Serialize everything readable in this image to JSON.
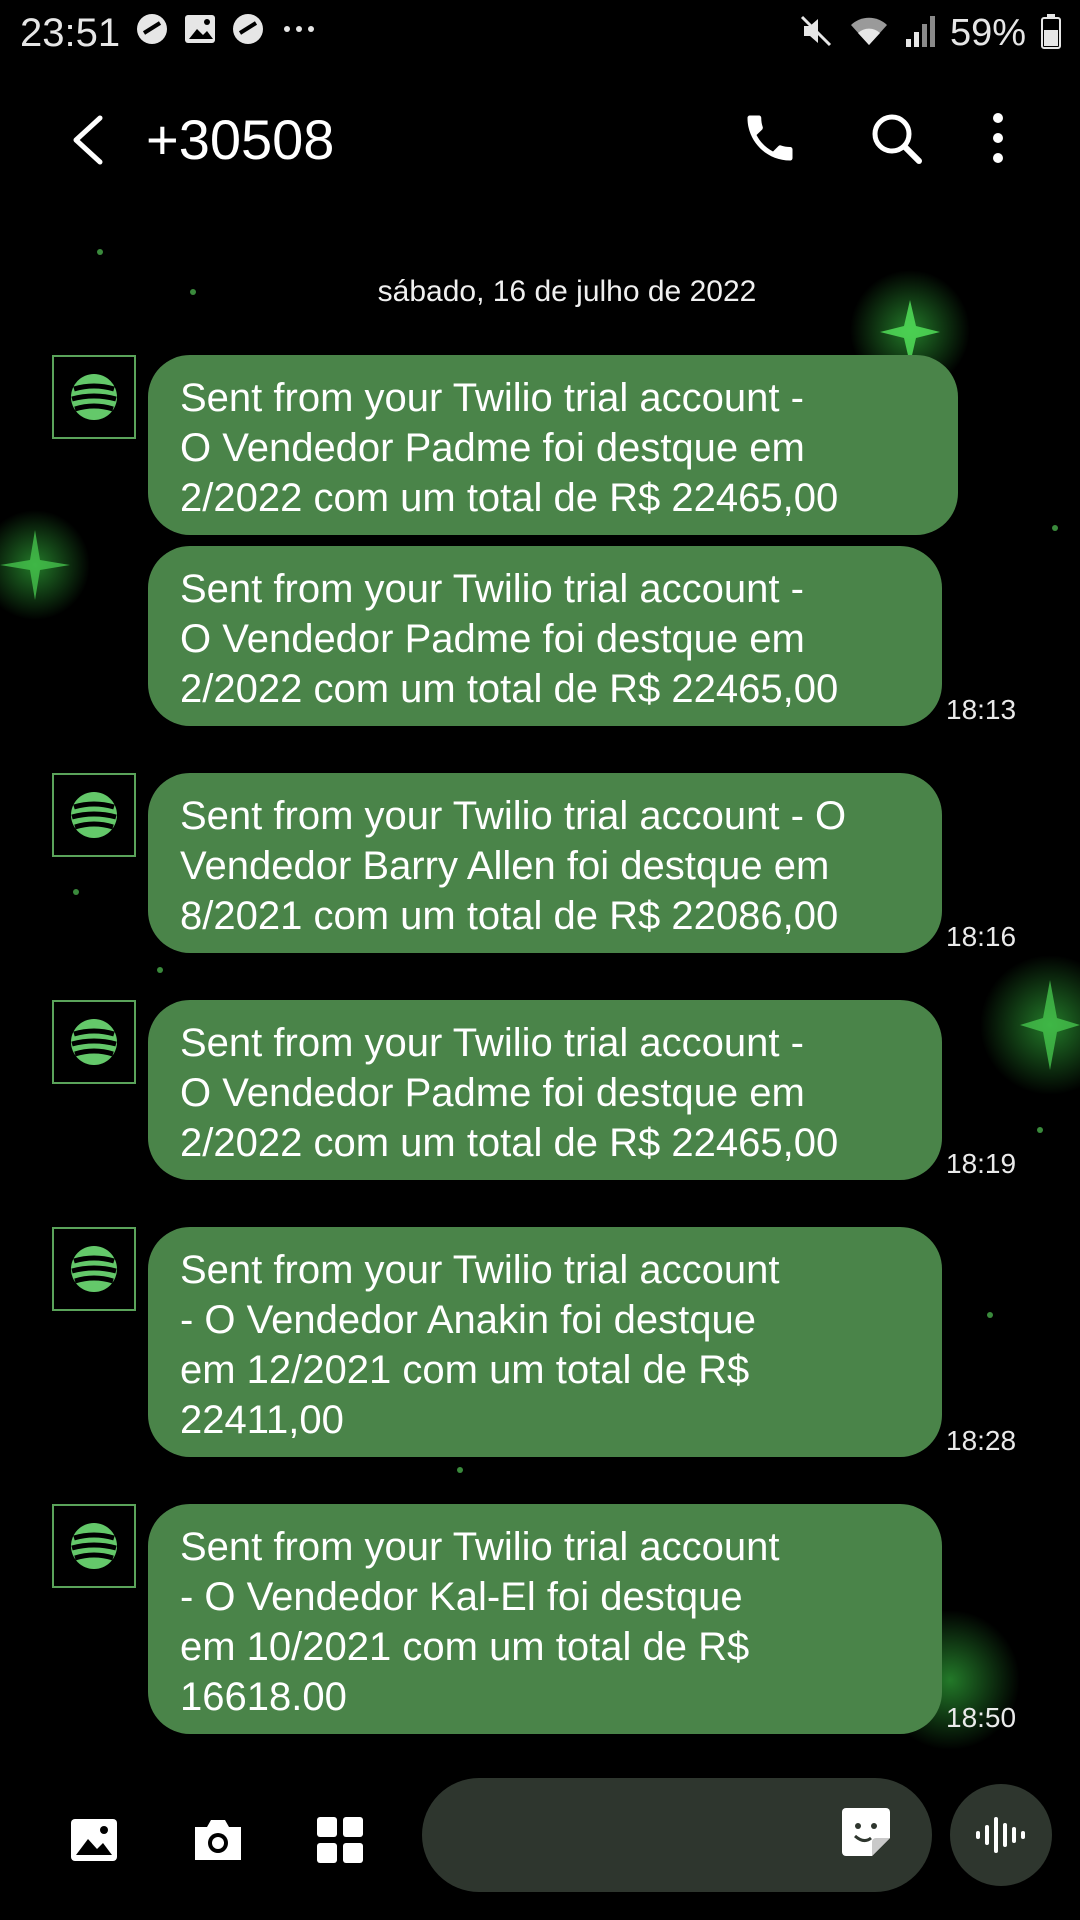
{
  "status_bar": {
    "time": "23:51",
    "left_icons": [
      "no-disturb-icon",
      "gallery-icon",
      "no-disturb-icon",
      "more-dots-icon"
    ],
    "right_icons": [
      "mute-icon",
      "wifi-icon",
      "signal-icon",
      "battery-icon"
    ],
    "battery_percent": "59%"
  },
  "header": {
    "title": "+30508",
    "back_icon": "chevron-left-icon",
    "call_icon": "phone-icon",
    "search_icon": "search-icon",
    "more_icon": "more-vertical-icon"
  },
  "conversation": {
    "date": "sábado, 16 de julho de 2022",
    "messages": [
      {
        "text": "Sent from your Twilio trial account -\nO Vendedor Padme foi destque em\n2/2022 com um total de R$ 22465,00",
        "time": ""
      },
      {
        "text": "Sent from your Twilio trial account -\nO Vendedor Padme foi destque em\n2/2022 com um total de R$ 22465,00",
        "time": "18:13"
      },
      {
        "text": "Sent from your Twilio trial account - O\nVendedor Barry Allen foi destque em\n8/2021 com um total de R$ 22086,00",
        "time": "18:16"
      },
      {
        "text": "Sent from your Twilio trial account -\nO Vendedor Padme foi destque em\n2/2022 com um total de R$ 22465,00",
        "time": "18:19"
      },
      {
        "text": "Sent from your Twilio trial account\n- O Vendedor Anakin foi destque\nem 12/2021 com um total de R$\n22411,00",
        "time": "18:28"
      },
      {
        "text": "Sent from your Twilio trial account\n- O Vendedor Kal-El foi destque\nem 10/2021 com um total de R$\n16618.00",
        "time": "18:50"
      }
    ]
  },
  "composer": {
    "gallery_icon": "image-icon",
    "camera_icon": "camera-icon",
    "apps_icon": "grid-icon",
    "input_value": "",
    "sticker_icon": "sticker-icon",
    "voice_icon": "voice-wave-icon"
  },
  "colors": {
    "background": "#000000",
    "bubble": "#4a8449",
    "accent_green": "#5aa35a",
    "composer": "#2e362e"
  }
}
